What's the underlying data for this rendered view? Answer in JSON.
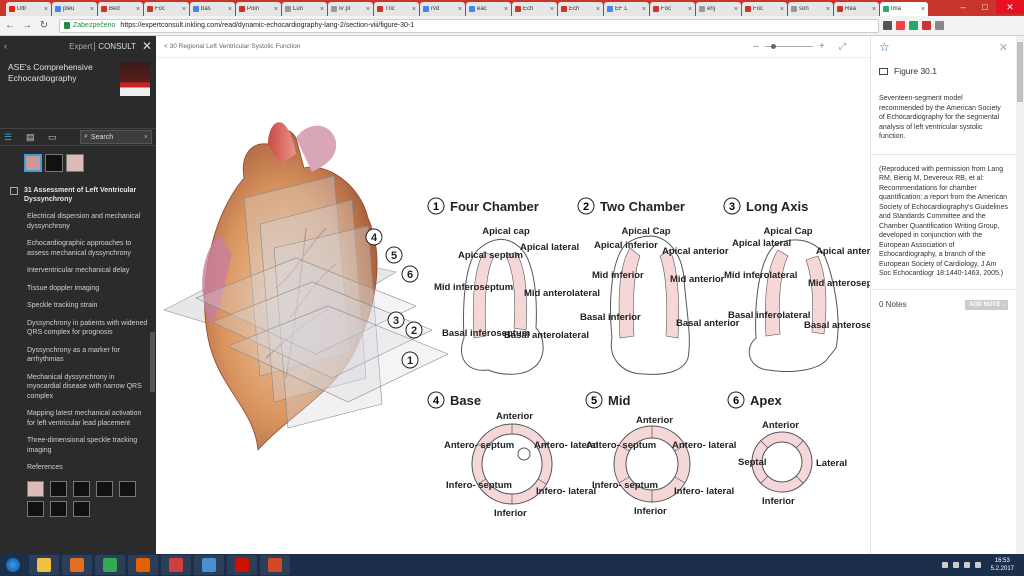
{
  "browser": {
    "tabs": [
      {
        "label": "Ultr",
        "color": "#e62117"
      },
      {
        "label": "pleu",
        "color": "#4285f4"
      },
      {
        "label": "Bed",
        "color": "#c9342b"
      },
      {
        "label": "Foc",
        "color": "#c9342b"
      },
      {
        "label": "bas",
        "color": "#4285f4"
      },
      {
        "label": "Poin",
        "color": "#c9342b"
      },
      {
        "label": "Lun",
        "color": "#999999"
      },
      {
        "label": "Iv pl",
        "color": "#999999"
      },
      {
        "label": "Tric",
        "color": "#c9342b"
      },
      {
        "label": "rvd",
        "color": "#4285f4"
      },
      {
        "label": "eac",
        "color": "#4285f4"
      },
      {
        "label": "Ech",
        "color": "#c9342b"
      },
      {
        "label": "Ech",
        "color": "#c9342b"
      },
      {
        "label": "EF L",
        "color": "#4285f4"
      },
      {
        "label": "Foc",
        "color": "#c9342b"
      },
      {
        "label": "ehj",
        "color": "#999999"
      },
      {
        "label": "Foc",
        "color": "#c9342b"
      },
      {
        "label": "son",
        "color": "#999999"
      },
      {
        "label": "Rea",
        "color": "#c9342b"
      },
      {
        "label": "Ima",
        "color": "#2aa876",
        "active": true
      }
    ],
    "tab_close": "×",
    "window_controls": {
      "min": "–",
      "max": "□",
      "close": "✕"
    },
    "back": "←",
    "forward": "→",
    "reload": "↻",
    "secure_label": "Zabezpečeno",
    "url": "https://expertconsult.inkling.com/read/dynamic-echocardiography-lang-2/section-viii/figure-30-1"
  },
  "sidebar": {
    "back_icon": "‹",
    "brand_expert": "Expert",
    "brand_consult": "CONSULT",
    "close": "✕",
    "book_title": "ASE's Comprehensive Echocardiography",
    "search_placeholder": "Search",
    "search_icon": "⌕",
    "search_clear": "×",
    "tool_icons": [
      "☰",
      "▤",
      "▭"
    ],
    "chapter_title": "31 Assessment of Left Ventricular Dyssynchrony",
    "toc": [
      "Electrical dispersion and mechanical dyssynchrony",
      "Echocardiographic approaches to assess mechanical dyssynchrony",
      "Interventricular mechanical delay",
      "Tissue doppler imaging",
      "Speckle tracking strain",
      "Dyssynchrony in patients with widened QRS complex for prognosis",
      "Dyssynchrony as a marker for arrhythmias",
      "Mechanical dyssynchrony in myocardial disease with narrow QRS complex",
      "Mapping latest mechanical activation for left ventricular lead placement",
      "Three-dimensional speckle tracking imaging",
      "References"
    ]
  },
  "content": {
    "breadcrumb": "< 30 Regional Left Ventricular Systolic Function",
    "zoom_minus": "–",
    "zoom_plus": "+",
    "fullscreen": "⤢",
    "figure": {
      "views": [
        {
          "num": "1",
          "title": "Four Chamber",
          "labels": [
            "Apical cap",
            "Apical septum",
            "Apical lateral",
            "Mid inferoseptum",
            "Mid anterolateral",
            "Basal inferoseptum",
            "Basal anterolateral"
          ]
        },
        {
          "num": "2",
          "title": "Two Chamber",
          "labels": [
            "Apical Cap",
            "Apical inferior",
            "Apical anterior",
            "Mid inferior",
            "Mid anterior",
            "Basal inferior",
            "Basal anterior"
          ]
        },
        {
          "num": "3",
          "title": "Long Axis",
          "labels": [
            "Apical Cap",
            "Apical lateral",
            "Apical anterior",
            "Mid inferolateral",
            "Mid anteroseptum",
            "Basal inferolateral",
            "Basal anteroseptum"
          ]
        },
        {
          "num": "4",
          "title": "Base",
          "labels": [
            "Anterior",
            "Antero- septum",
            "Antero- lateral",
            "Infero- septum",
            "Infero- lateral",
            "Inferior"
          ]
        },
        {
          "num": "5",
          "title": "Mid",
          "labels": [
            "Anterior",
            "Antero- septum",
            "Antero- lateral",
            "Infero- septum",
            "Infero- lateral",
            "Inferior"
          ]
        },
        {
          "num": "6",
          "title": "Apex",
          "labels": [
            "Anterior",
            "Septal",
            "Lateral",
            "Inferior"
          ]
        }
      ],
      "plane_numbers": [
        "4",
        "5",
        "6",
        "3",
        "2",
        "1"
      ]
    }
  },
  "panel": {
    "star": "☆",
    "close": "✕",
    "figure_label": "Figure 30.1",
    "caption": "Seventeen-segment model recommended by the American Society of Echocardiography for the segmental analysis of left ventricular systolic function.",
    "reproduction": "(Reproduced with permission from Lang RM, Bierig M, Devereux RB, et al: Recommendations for chamber quantification: a report from the American Society of Echocardiography's Guidelines and Standards Committee and the Chamber Quantification Writing Group, developed in conjunction with the European Association of Echocardiography, a branch of the European Society of Cardiology, J Am Soc Echocardiogr 18:1440-1463, 2005.)",
    "notes": "0 Notes",
    "add_note": "ADD NOTE ›"
  },
  "taskbar": {
    "apps": [
      {
        "name": "explorer",
        "color": "#f0c040"
      },
      {
        "name": "media",
        "color": "#e07020"
      },
      {
        "name": "chrome",
        "color": "#34a853"
      },
      {
        "name": "firefox",
        "color": "#e66000"
      },
      {
        "name": "ccleaner",
        "color": "#d04040"
      },
      {
        "name": "files",
        "color": "#4a90d0"
      },
      {
        "name": "acrobat",
        "color": "#cc1100"
      },
      {
        "name": "powerpoint",
        "color": "#d24726"
      }
    ],
    "time": "16:53",
    "date": "5.2.2017"
  }
}
